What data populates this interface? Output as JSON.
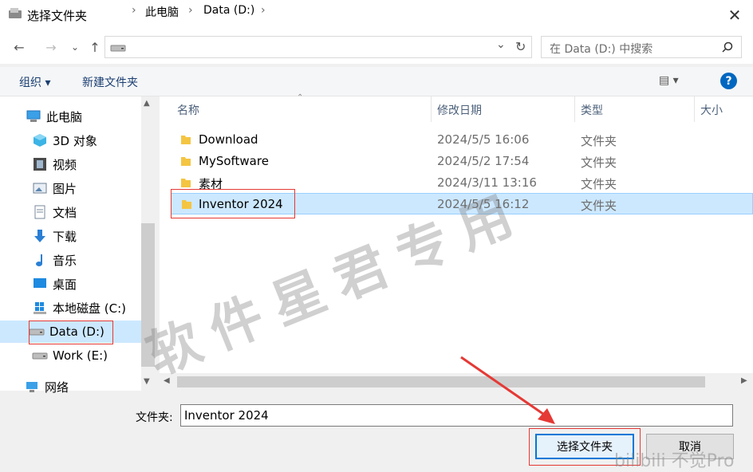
{
  "window": {
    "title": "选择文件夹",
    "close_glyph": "✕"
  },
  "nav_buttons": {
    "back": "←",
    "forward": "→",
    "recent": "⌄",
    "up": "↑"
  },
  "address": {
    "segments": [
      "此电脑",
      "Data (D:)"
    ],
    "separator": "›",
    "dropdown": "⌄",
    "refresh": "↻"
  },
  "search": {
    "placeholder": "在 Data (D:) 中搜索",
    "icon": "search-icon"
  },
  "commandbar": {
    "organize": "组织 ▾",
    "new_folder": "新建文件夹",
    "view_glyph": "▤ ▾",
    "help": "?"
  },
  "sidebar": {
    "items": [
      {
        "label": "此电脑",
        "icon": "computer-icon"
      },
      {
        "label": "3D 对象",
        "icon": "cube-icon"
      },
      {
        "label": "视频",
        "icon": "film-icon"
      },
      {
        "label": "图片",
        "icon": "picture-icon"
      },
      {
        "label": "文档",
        "icon": "document-icon"
      },
      {
        "label": "下载",
        "icon": "download-icon"
      },
      {
        "label": "音乐",
        "icon": "music-icon"
      },
      {
        "label": "桌面",
        "icon": "desktop-icon"
      },
      {
        "label": "本地磁盘 (C:)",
        "icon": "windows-drive-icon"
      },
      {
        "label": "Data (D:)",
        "icon": "drive-icon",
        "selected": true
      },
      {
        "label": "Work (E:)",
        "icon": "drive-icon"
      },
      {
        "label": "网络",
        "icon": "network-icon"
      }
    ]
  },
  "columns": {
    "name": "名称",
    "modified": "修改日期",
    "type": "类型",
    "size": "大小"
  },
  "files": [
    {
      "name": "Download",
      "modified": "2024/5/5 16:06",
      "type": "文件夹"
    },
    {
      "name": "MySoftware",
      "modified": "2024/5/2 17:54",
      "type": "文件夹"
    },
    {
      "name": "素材",
      "modified": "2024/3/11 13:16",
      "type": "文件夹"
    },
    {
      "name": "Inventor 2024",
      "modified": "2024/5/5 16:12",
      "type": "文件夹",
      "selected": true
    }
  ],
  "footer": {
    "folder_label": "文件夹:",
    "folder_value": "Inventor 2024",
    "select_button": "选择文件夹",
    "cancel_button": "取消"
  },
  "watermark": {
    "text": "软件星君专用",
    "corner": "bilibili 不觉Pro"
  },
  "colors": {
    "selection": "#cce8ff",
    "accent": "#0078d7",
    "annotation": "#e53935"
  }
}
